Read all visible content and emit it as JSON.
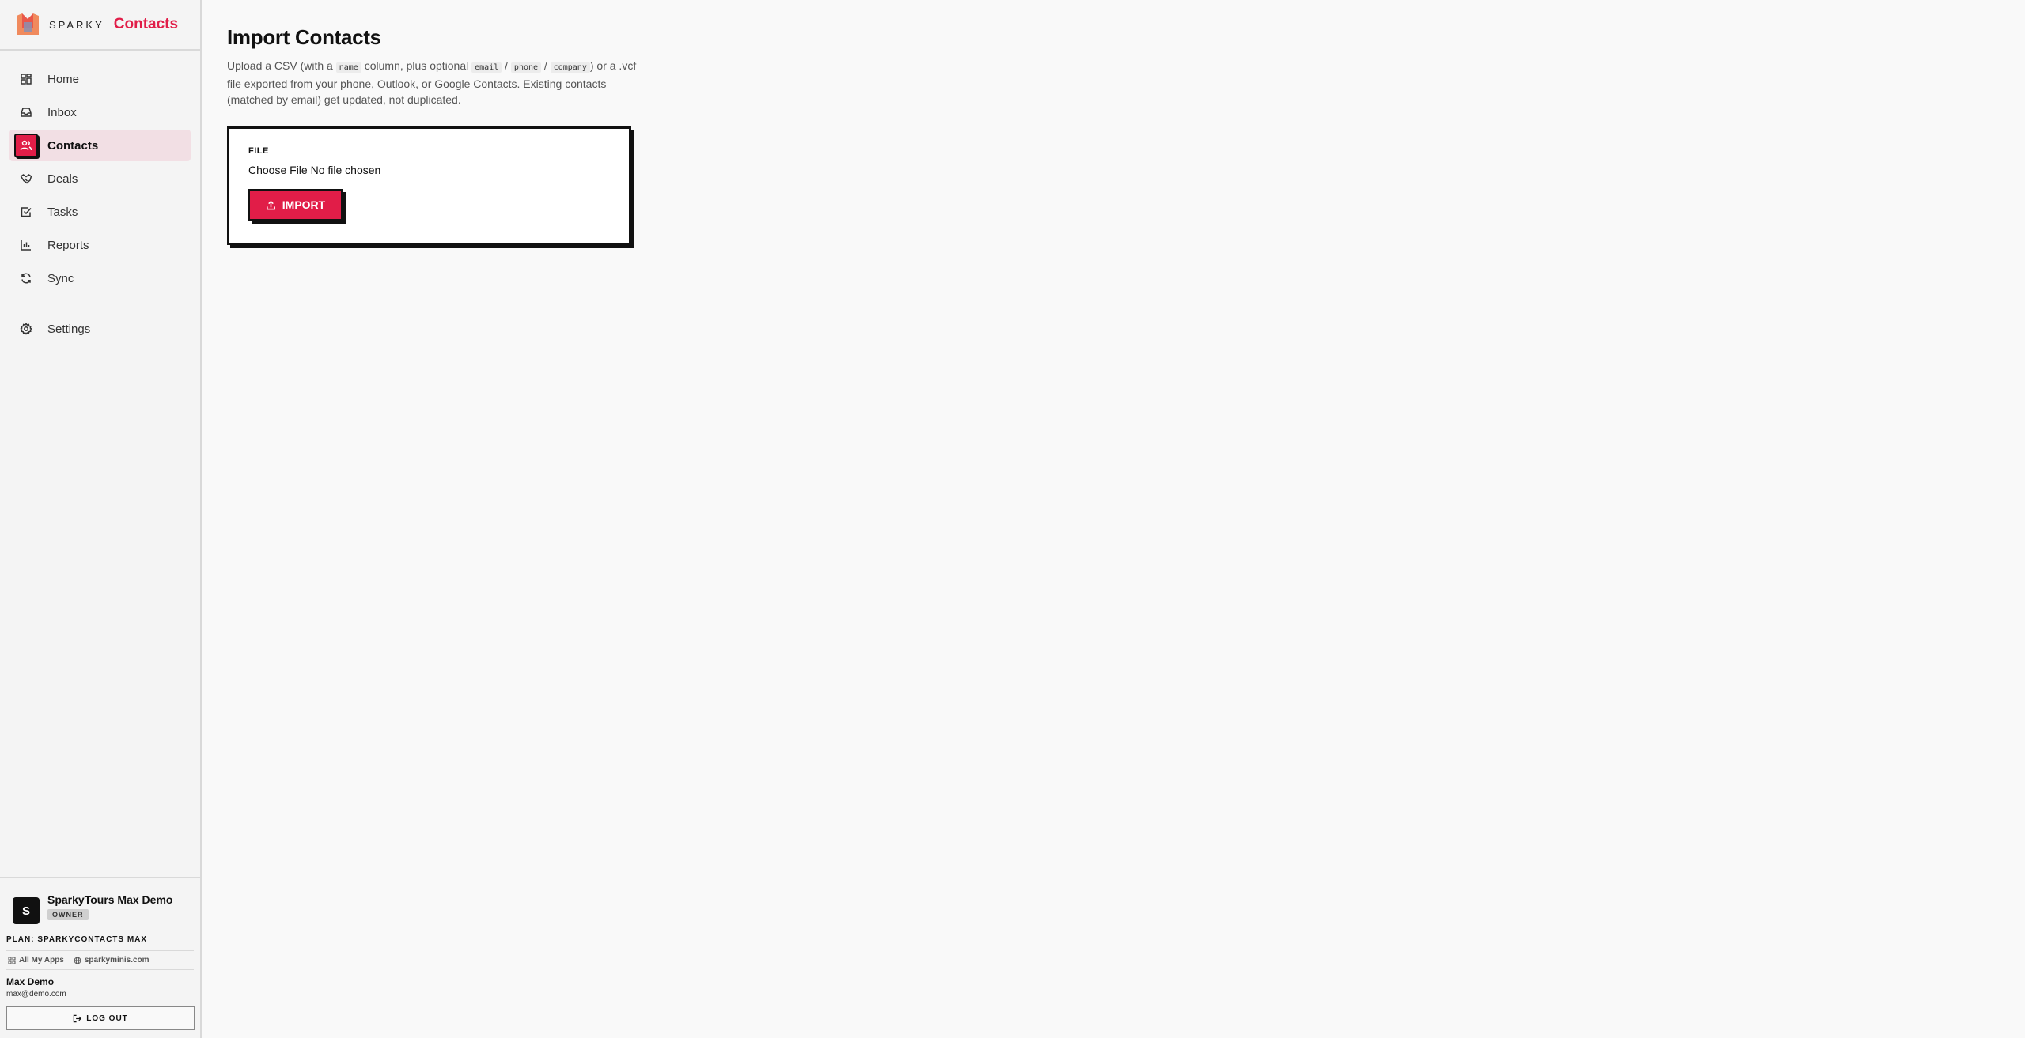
{
  "brand": {
    "prefix": "SPARKY",
    "name": "Contacts",
    "accent": "#e11d48"
  },
  "nav": {
    "items": [
      {
        "label": "Home",
        "icon": "dashboard-icon"
      },
      {
        "label": "Inbox",
        "icon": "inbox-icon"
      },
      {
        "label": "Contacts",
        "icon": "users-icon",
        "active": true
      },
      {
        "label": "Deals",
        "icon": "handshake-icon"
      },
      {
        "label": "Tasks",
        "icon": "checkbox-icon"
      },
      {
        "label": "Reports",
        "icon": "bar-chart-icon"
      },
      {
        "label": "Sync",
        "icon": "refresh-icon"
      }
    ],
    "settings": {
      "label": "Settings",
      "icon": "gear-icon"
    }
  },
  "account": {
    "org_initial": "S",
    "org_name": "SparkyTours Max Demo",
    "role": "OWNER",
    "plan": "PLAN: SPARKYCONTACTS MAX",
    "links": {
      "apps": "All My Apps",
      "site": "sparkyminis.com"
    },
    "user_name": "Max Demo",
    "user_email": "max@demo.com",
    "logout": "LOG OUT"
  },
  "main": {
    "title": "Import Contacts",
    "desc": {
      "t1": "Upload a CSV (with a ",
      "c1": "name",
      "t2": " column, plus optional ",
      "c2": "email",
      "s1": " / ",
      "c3": "phone",
      "s2": " / ",
      "c4": "company",
      "t3": ") or a .vcf file exported from your phone, Outlook, or Google Contacts. Existing contacts (matched by email) get updated, not duplicated."
    },
    "form": {
      "label": "FILE",
      "choose": "Choose File",
      "no_file": "No file chosen",
      "import": "IMPORT"
    }
  }
}
